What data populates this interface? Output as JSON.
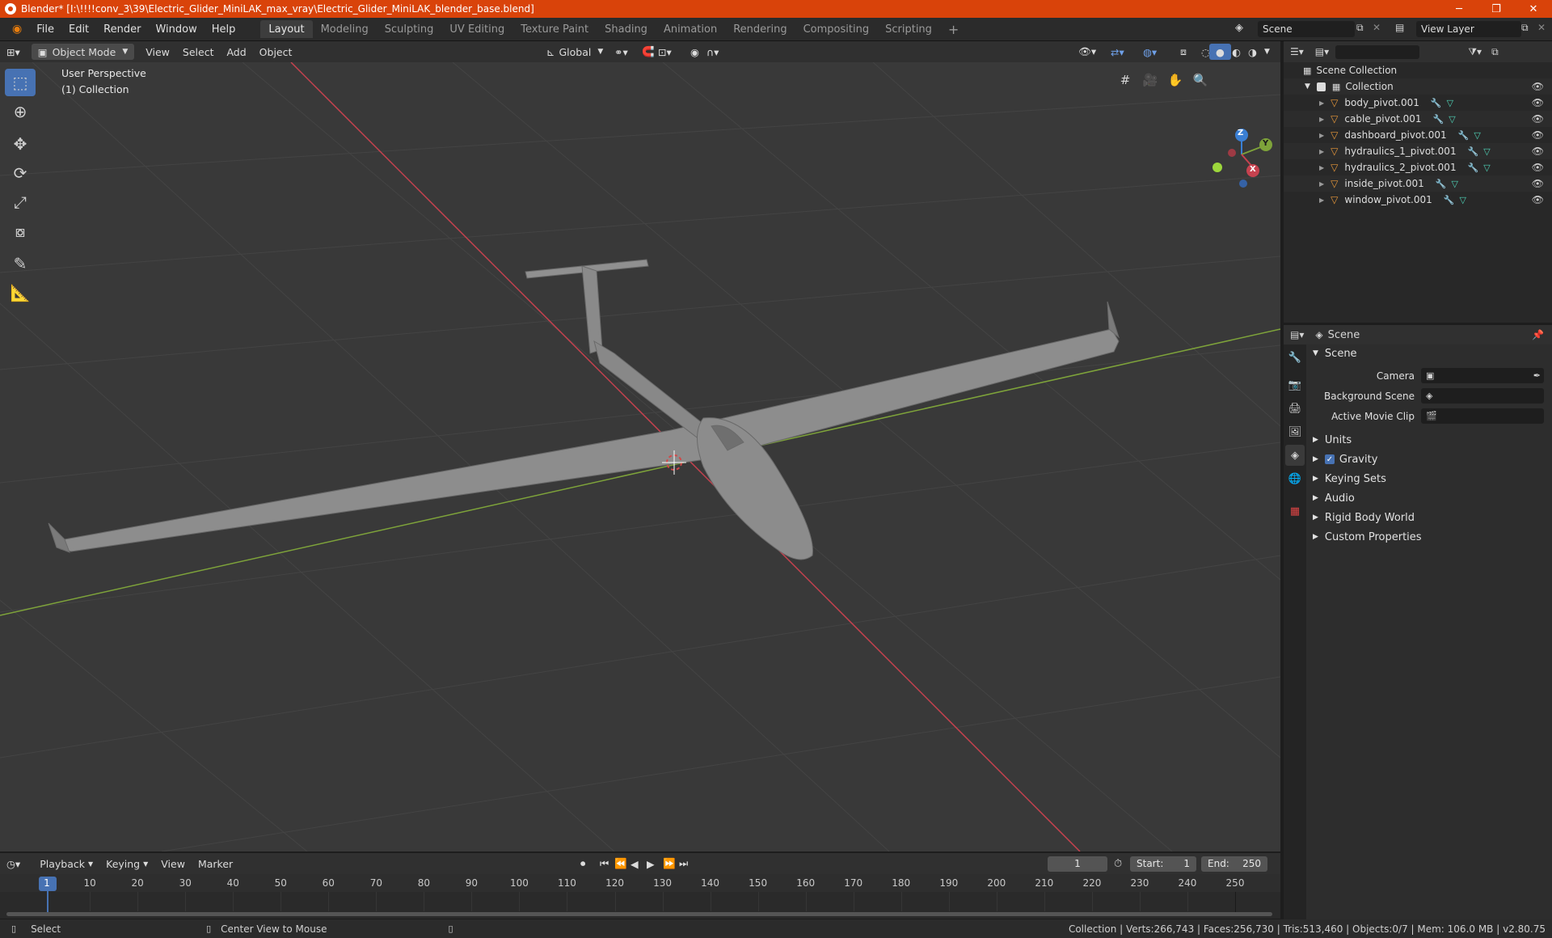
{
  "window": {
    "title": "Blender* [I:\\!!!!conv_3\\39\\Electric_Glider_MiniLAK_max_vray\\Electric_Glider_MiniLAK_blender_base.blend]",
    "minimize": "─",
    "maximize": "❐",
    "close": "✕"
  },
  "menu": {
    "file": "File",
    "edit": "Edit",
    "render": "Render",
    "window": "Window",
    "help": "Help"
  },
  "workspaces": [
    "Layout",
    "Modeling",
    "Sculpting",
    "UV Editing",
    "Texture Paint",
    "Shading",
    "Animation",
    "Rendering",
    "Compositing",
    "Scripting"
  ],
  "scene_field": "Scene",
  "view_layer_field": "View Layer",
  "viewport": {
    "mode": "Object Mode",
    "menus": {
      "view": "View",
      "select": "Select",
      "add": "Add",
      "object": "Object"
    },
    "orientation": "Global",
    "perspective_label": "User Perspective",
    "collection_label": "(1) Collection",
    "axis_labels": {
      "x": "X",
      "y": "Y",
      "z": "Z"
    }
  },
  "outliner": {
    "root": "Scene Collection",
    "collection": "Collection",
    "items": [
      "body_pivot.001",
      "cable_pivot.001",
      "dashboard_pivot.001",
      "hydraulics_1_pivot.001",
      "hydraulics_2_pivot.001",
      "inside_pivot.001",
      "window_pivot.001"
    ]
  },
  "properties": {
    "header": "Scene",
    "panel_title": "Scene",
    "fields": {
      "camera": "Camera",
      "background_scene": "Background Scene",
      "active_movie_clip": "Active Movie Clip"
    },
    "subpanels": {
      "units": "Units",
      "gravity": "Gravity",
      "keying_sets": "Keying Sets",
      "audio": "Audio",
      "rigid_body_world": "Rigid Body World",
      "custom_properties": "Custom Properties"
    }
  },
  "timeline": {
    "menus": {
      "playback": "Playback",
      "keying": "Keying",
      "view": "View",
      "marker": "Marker"
    },
    "current_frame": "1",
    "start_label": "Start:",
    "start": "1",
    "end_label": "End:",
    "end": "250",
    "ticks": [
      "1",
      "10",
      "20",
      "30",
      "40",
      "50",
      "60",
      "70",
      "80",
      "90",
      "100",
      "110",
      "120",
      "130",
      "140",
      "150",
      "160",
      "170",
      "180",
      "190",
      "200",
      "210",
      "220",
      "230",
      "240",
      "250"
    ]
  },
  "status": {
    "left": "Select",
    "middle": "Center View to Mouse",
    "right": "Collection | Verts:266,743 | Faces:256,730 | Tris:513,460 | Objects:0/7 | Mem: 106.0 MB | v2.80.75"
  },
  "colors": {
    "accent": "#4772b3",
    "titlebar": "#d9430a",
    "x_axis": "#c6424f",
    "y_axis": "#7ea33a",
    "z_axis": "#3a7fd4"
  }
}
